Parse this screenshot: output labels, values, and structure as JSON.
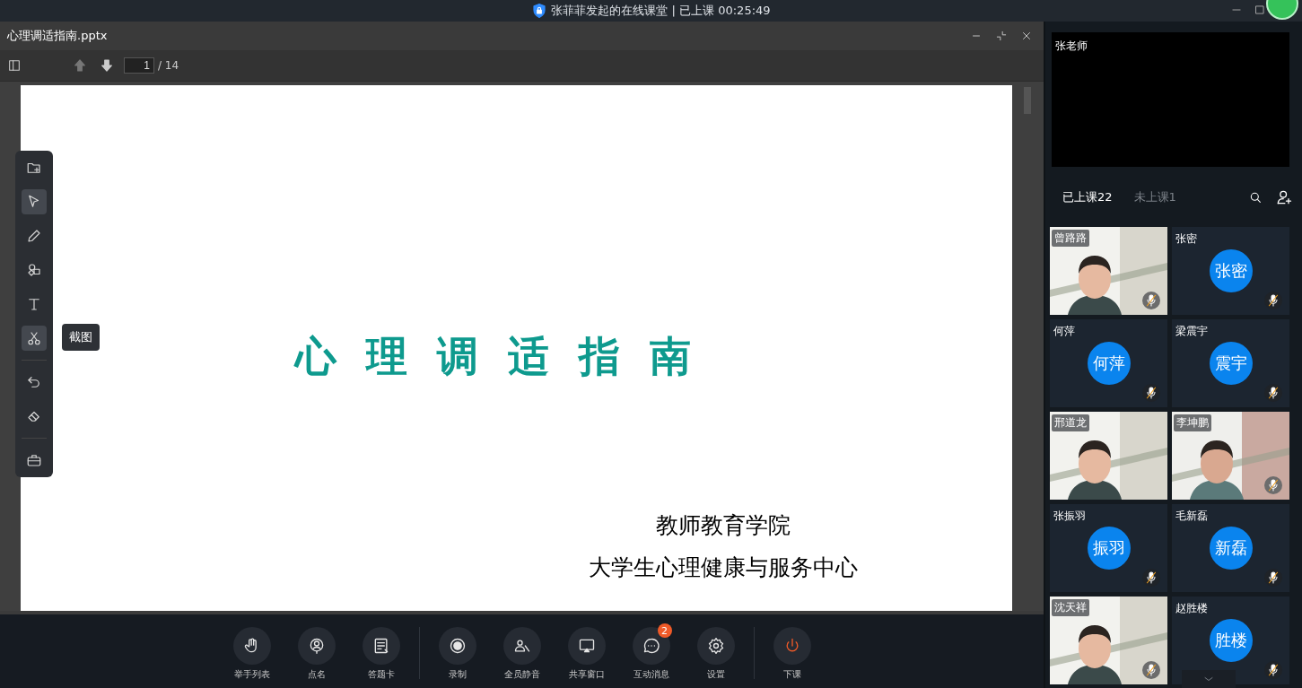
{
  "window": {
    "title": "张菲菲发起的在线课堂 | 已上课 00:25:49"
  },
  "document": {
    "title": "心理调适指南.pptx",
    "page": "1",
    "page_total": "/ 14"
  },
  "slide": {
    "title": "心理调适指南",
    "lines": [
      "教师教育学院",
      "大学生心理健康与服务中心"
    ]
  },
  "tool_groups": [
    [
      {
        "kind": "add-file",
        "selected": false
      },
      {
        "kind": "cursor",
        "selected": true
      },
      {
        "kind": "pencil",
        "selected": false
      },
      {
        "kind": "shapes",
        "selected": false
      },
      {
        "kind": "text",
        "selected": false
      },
      {
        "kind": "scissors",
        "selected": true,
        "tooltip": "截图"
      }
    ],
    [
      {
        "kind": "undo",
        "selected": false
      },
      {
        "kind": "eraser",
        "selected": false
      }
    ],
    [
      {
        "kind": "toolbox",
        "selected": false
      }
    ]
  ],
  "teacher": {
    "name": "张老师"
  },
  "tabs": [
    {
      "label": "已上课22",
      "selected": true
    },
    {
      "label": "未上课1",
      "selected": false
    }
  ],
  "participants": [
    {
      "name": "曾路路",
      "kind": "video",
      "muted": true
    },
    {
      "name": "张密",
      "kind": "avatar",
      "avatar": "张密",
      "muted": true
    },
    {
      "name": "何萍",
      "kind": "avatar",
      "avatar": "何萍",
      "muted": true
    },
    {
      "name": "梁震宇",
      "kind": "avatar",
      "avatar": "震宇",
      "muted": true
    },
    {
      "name": "邢道龙",
      "kind": "video",
      "muted": false
    },
    {
      "name": "李坤鹏",
      "kind": "video",
      "muted": true
    },
    {
      "name": "张振羽",
      "kind": "avatar",
      "avatar": "振羽",
      "muted": true
    },
    {
      "name": "毛新磊",
      "kind": "avatar",
      "avatar": "新磊",
      "muted": true
    },
    {
      "name": "沈天祥",
      "kind": "video",
      "muted": true
    },
    {
      "name": "赵胜楼",
      "kind": "avatar",
      "avatar": "胜楼",
      "muted": true
    }
  ],
  "control_groups": [
    [
      {
        "kind": "hand",
        "label": "举手列表"
      },
      {
        "kind": "rollcall",
        "label": "点名"
      },
      {
        "kind": "answer-card",
        "label": "答题卡"
      }
    ],
    [
      {
        "kind": "record",
        "label": "录制"
      },
      {
        "kind": "mute-all",
        "label": "全员静音"
      },
      {
        "kind": "share",
        "label": "共享窗口"
      },
      {
        "kind": "chat",
        "label": "互动消息",
        "badge": "2"
      },
      {
        "kind": "settings",
        "label": "设置"
      }
    ],
    [
      {
        "kind": "power",
        "label": "下课"
      }
    ]
  ]
}
